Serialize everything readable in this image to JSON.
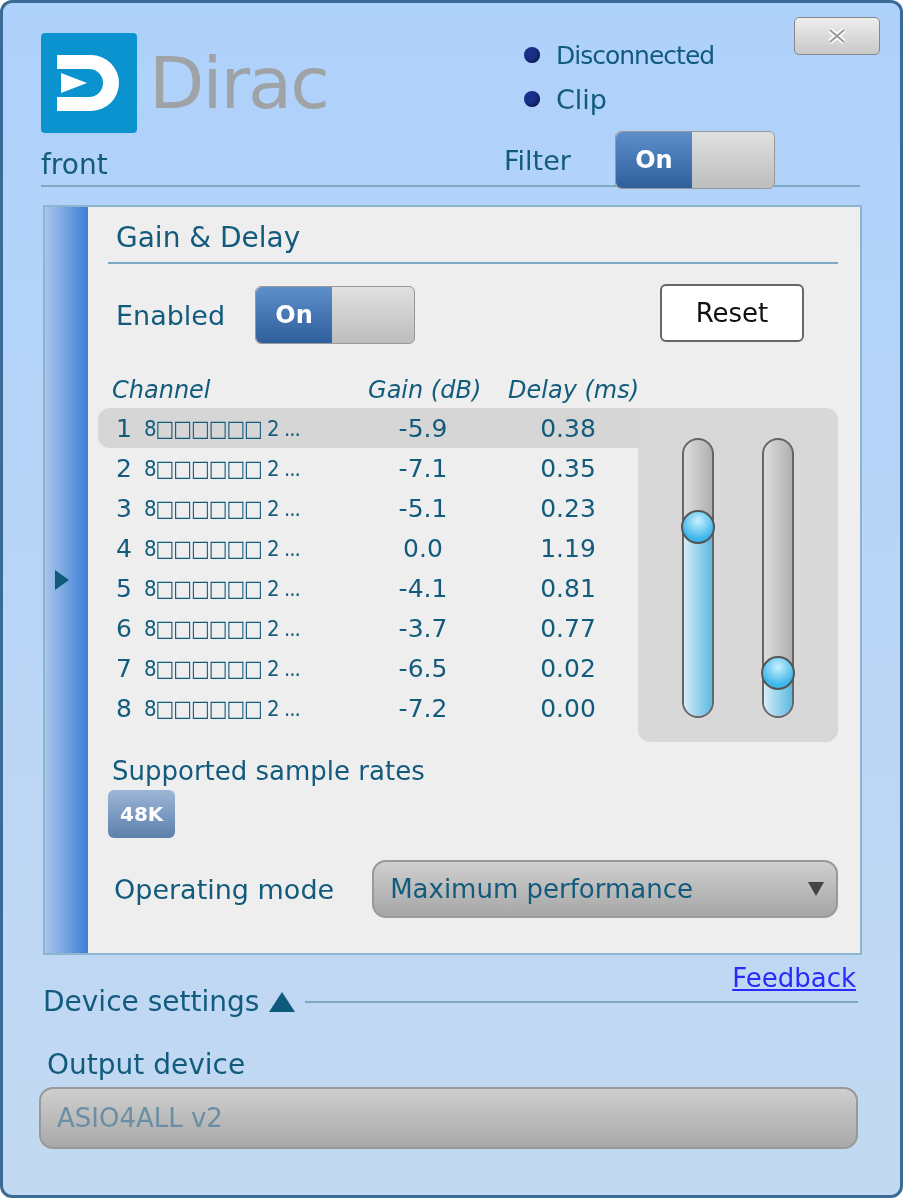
{
  "logo": {
    "text": "Dirac"
  },
  "preset": "front",
  "status": [
    {
      "label": "Disconnected",
      "color": "#1a2f8a"
    },
    {
      "label": "Clip",
      "color": "#1a2f8a"
    }
  ],
  "filter": {
    "label": "Filter",
    "toggle": {
      "label": "On",
      "on": true
    }
  },
  "panel": {
    "title": "Gain & Delay",
    "enabled": {
      "label": "Enabled",
      "toggle": {
        "label": "On",
        "on": true
      }
    },
    "reset_button": "Reset",
    "columns": [
      "Channel",
      "Gain (dB)",
      "Delay (ms)"
    ],
    "rows": [
      {
        "index": "1",
        "name": "8□□□□□□ 2 ...",
        "gain": "-5.9",
        "delay": "0.38",
        "selected": true
      },
      {
        "index": "2",
        "name": "8□□□□□□ 2 ...",
        "gain": "-7.1",
        "delay": "0.35",
        "selected": false
      },
      {
        "index": "3",
        "name": "8□□□□□□ 2 ...",
        "gain": "-5.1",
        "delay": "0.23",
        "selected": false
      },
      {
        "index": "4",
        "name": "8□□□□□□ 2 ...",
        "gain": "0.0",
        "delay": "1.19",
        "selected": false
      },
      {
        "index": "5",
        "name": "8□□□□□□ 2 ...",
        "gain": "-4.1",
        "delay": "0.81",
        "selected": false
      },
      {
        "index": "6",
        "name": "8□□□□□□ 2 ...",
        "gain": "-3.7",
        "delay": "0.77",
        "selected": false
      },
      {
        "index": "7",
        "name": "8□□□□□□ 2 ...",
        "gain": "-6.5",
        "delay": "0.02",
        "selected": false
      },
      {
        "index": "8",
        "name": "8□□□□□□ 2 ...",
        "gain": "-7.2",
        "delay": "0.00",
        "selected": false
      }
    ],
    "sliders": [
      {
        "level": 0.69
      },
      {
        "level": 0.16
      }
    ],
    "sample_rates_label": "Supported sample rates",
    "sample_rates": [
      "48K"
    ],
    "operating_mode": {
      "label": "Operating mode",
      "value": "Maximum performance"
    }
  },
  "feedback_link": "Feedback",
  "device_settings": {
    "label": "Device settings",
    "output_label": "Output device",
    "output_value": "ASIO4ALL v2"
  }
}
